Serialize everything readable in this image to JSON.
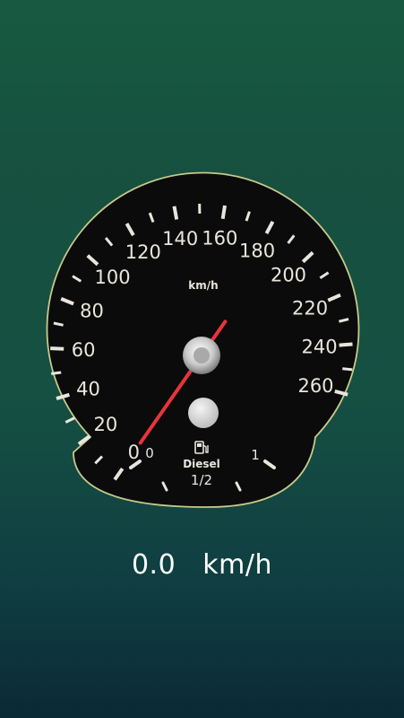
{
  "speedometer": {
    "unit_label": "km/h",
    "speed_scale": [
      0,
      20,
      40,
      60,
      80,
      100,
      120,
      140,
      160,
      180,
      200,
      220,
      240,
      260
    ],
    "current_speed_kmh": 0.0,
    "fuel": {
      "empty_label": "0",
      "half_label": "1/2",
      "full_label": "1",
      "fuel_type": "Diesel",
      "icon": "fuel-pump-icon"
    }
  },
  "readout": {
    "value": "0.0",
    "unit": "km/h"
  },
  "colors": {
    "needle": "#e8343a",
    "dial_face": "#0b0b0b",
    "dial_rim": "#c8c98a",
    "markings": "#e8e6dc"
  }
}
